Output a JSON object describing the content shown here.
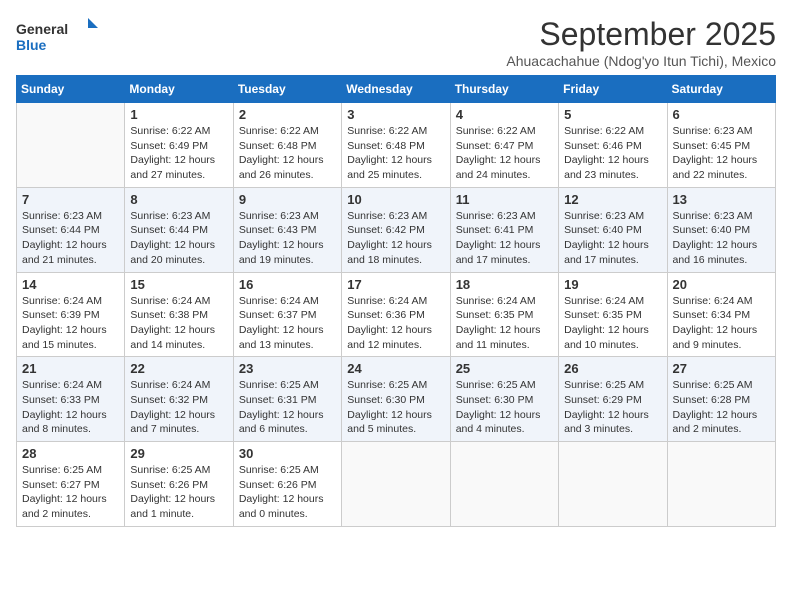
{
  "logo": {
    "line1": "General",
    "line2": "Blue"
  },
  "title": "September 2025",
  "subtitle": "Ahuacachahue (Ndog'yo Itun Tichi), Mexico",
  "days_of_week": [
    "Sunday",
    "Monday",
    "Tuesday",
    "Wednesday",
    "Thursday",
    "Friday",
    "Saturday"
  ],
  "weeks": [
    [
      {
        "day": "",
        "info": ""
      },
      {
        "day": "1",
        "info": "Sunrise: 6:22 AM\nSunset: 6:49 PM\nDaylight: 12 hours\nand 27 minutes."
      },
      {
        "day": "2",
        "info": "Sunrise: 6:22 AM\nSunset: 6:48 PM\nDaylight: 12 hours\nand 26 minutes."
      },
      {
        "day": "3",
        "info": "Sunrise: 6:22 AM\nSunset: 6:48 PM\nDaylight: 12 hours\nand 25 minutes."
      },
      {
        "day": "4",
        "info": "Sunrise: 6:22 AM\nSunset: 6:47 PM\nDaylight: 12 hours\nand 24 minutes."
      },
      {
        "day": "5",
        "info": "Sunrise: 6:22 AM\nSunset: 6:46 PM\nDaylight: 12 hours\nand 23 minutes."
      },
      {
        "day": "6",
        "info": "Sunrise: 6:23 AM\nSunset: 6:45 PM\nDaylight: 12 hours\nand 22 minutes."
      }
    ],
    [
      {
        "day": "7",
        "info": "Sunrise: 6:23 AM\nSunset: 6:44 PM\nDaylight: 12 hours\nand 21 minutes."
      },
      {
        "day": "8",
        "info": "Sunrise: 6:23 AM\nSunset: 6:44 PM\nDaylight: 12 hours\nand 20 minutes."
      },
      {
        "day": "9",
        "info": "Sunrise: 6:23 AM\nSunset: 6:43 PM\nDaylight: 12 hours\nand 19 minutes."
      },
      {
        "day": "10",
        "info": "Sunrise: 6:23 AM\nSunset: 6:42 PM\nDaylight: 12 hours\nand 18 minutes."
      },
      {
        "day": "11",
        "info": "Sunrise: 6:23 AM\nSunset: 6:41 PM\nDaylight: 12 hours\nand 17 minutes."
      },
      {
        "day": "12",
        "info": "Sunrise: 6:23 AM\nSunset: 6:40 PM\nDaylight: 12 hours\nand 17 minutes."
      },
      {
        "day": "13",
        "info": "Sunrise: 6:23 AM\nSunset: 6:40 PM\nDaylight: 12 hours\nand 16 minutes."
      }
    ],
    [
      {
        "day": "14",
        "info": "Sunrise: 6:24 AM\nSunset: 6:39 PM\nDaylight: 12 hours\nand 15 minutes."
      },
      {
        "day": "15",
        "info": "Sunrise: 6:24 AM\nSunset: 6:38 PM\nDaylight: 12 hours\nand 14 minutes."
      },
      {
        "day": "16",
        "info": "Sunrise: 6:24 AM\nSunset: 6:37 PM\nDaylight: 12 hours\nand 13 minutes."
      },
      {
        "day": "17",
        "info": "Sunrise: 6:24 AM\nSunset: 6:36 PM\nDaylight: 12 hours\nand 12 minutes."
      },
      {
        "day": "18",
        "info": "Sunrise: 6:24 AM\nSunset: 6:35 PM\nDaylight: 12 hours\nand 11 minutes."
      },
      {
        "day": "19",
        "info": "Sunrise: 6:24 AM\nSunset: 6:35 PM\nDaylight: 12 hours\nand 10 minutes."
      },
      {
        "day": "20",
        "info": "Sunrise: 6:24 AM\nSunset: 6:34 PM\nDaylight: 12 hours\nand 9 minutes."
      }
    ],
    [
      {
        "day": "21",
        "info": "Sunrise: 6:24 AM\nSunset: 6:33 PM\nDaylight: 12 hours\nand 8 minutes."
      },
      {
        "day": "22",
        "info": "Sunrise: 6:24 AM\nSunset: 6:32 PM\nDaylight: 12 hours\nand 7 minutes."
      },
      {
        "day": "23",
        "info": "Sunrise: 6:25 AM\nSunset: 6:31 PM\nDaylight: 12 hours\nand 6 minutes."
      },
      {
        "day": "24",
        "info": "Sunrise: 6:25 AM\nSunset: 6:30 PM\nDaylight: 12 hours\nand 5 minutes."
      },
      {
        "day": "25",
        "info": "Sunrise: 6:25 AM\nSunset: 6:30 PM\nDaylight: 12 hours\nand 4 minutes."
      },
      {
        "day": "26",
        "info": "Sunrise: 6:25 AM\nSunset: 6:29 PM\nDaylight: 12 hours\nand 3 minutes."
      },
      {
        "day": "27",
        "info": "Sunrise: 6:25 AM\nSunset: 6:28 PM\nDaylight: 12 hours\nand 2 minutes."
      }
    ],
    [
      {
        "day": "28",
        "info": "Sunrise: 6:25 AM\nSunset: 6:27 PM\nDaylight: 12 hours\nand 2 minutes."
      },
      {
        "day": "29",
        "info": "Sunrise: 6:25 AM\nSunset: 6:26 PM\nDaylight: 12 hours\nand 1 minute."
      },
      {
        "day": "30",
        "info": "Sunrise: 6:25 AM\nSunset: 6:26 PM\nDaylight: 12 hours\nand 0 minutes."
      },
      {
        "day": "",
        "info": ""
      },
      {
        "day": "",
        "info": ""
      },
      {
        "day": "",
        "info": ""
      },
      {
        "day": "",
        "info": ""
      }
    ]
  ]
}
